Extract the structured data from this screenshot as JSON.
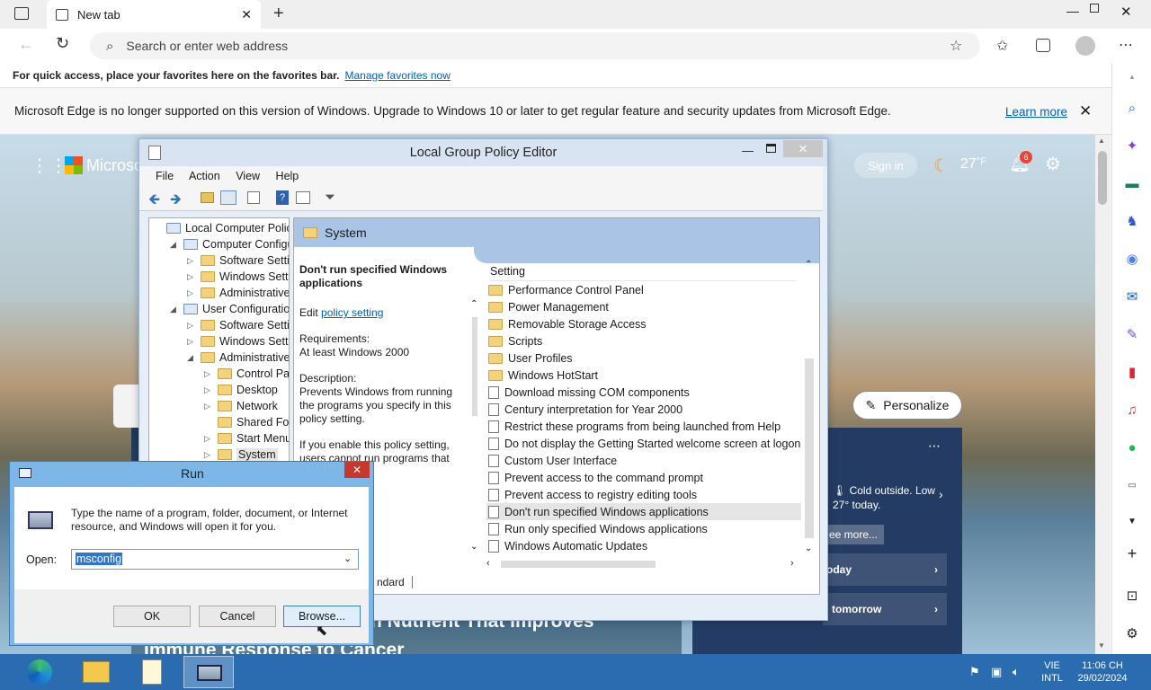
{
  "browser": {
    "tab_title": "New tab",
    "address_placeholder": "Search or enter web address",
    "favorites_text": "For quick access, place your favorites here on the favorites bar.",
    "favorites_link": "Manage favorites now",
    "info_text": "Microsoft Edge is no longer supported on this version of Windows. Upgrade to Windows 10 or later to get regular feature and security updates from Microsoft Edge.",
    "info_link": "Learn more"
  },
  "page": {
    "brand": "Microso",
    "sign_in": "Sign in",
    "temperature": "27",
    "temp_unit": "°F",
    "notif_count": "6",
    "personalize": "Personalize",
    "weather_text": "Cold outside. Low 27° today.",
    "see_more": "ee more...",
    "today": "oday",
    "tomorrow": "tomorrow",
    "headline1": "n Nutrient That Improves",
    "headline2": "Immune Response to Cancer"
  },
  "gpedit": {
    "title": "Local Group Policy Editor",
    "menu": [
      "File",
      "Action",
      "View",
      "Help"
    ],
    "tree": [
      {
        "label": "Local Computer Policy",
        "indent": 0,
        "arrow": ""
      },
      {
        "label": "Computer Configura",
        "indent": 1,
        "arrow": "◢"
      },
      {
        "label": "Software Settings",
        "indent": 2,
        "arrow": "▷"
      },
      {
        "label": "Windows Setting",
        "indent": 2,
        "arrow": "▷"
      },
      {
        "label": "Administrative Te",
        "indent": 2,
        "arrow": "▷"
      },
      {
        "label": "User Configuration",
        "indent": 1,
        "arrow": "◢"
      },
      {
        "label": "Software Settings",
        "indent": 2,
        "arrow": "▷"
      },
      {
        "label": "Windows Setting",
        "indent": 2,
        "arrow": "▷"
      },
      {
        "label": "Administrative Te",
        "indent": 2,
        "arrow": "◢"
      },
      {
        "label": "Control Panel",
        "indent": 3,
        "arrow": "▷"
      },
      {
        "label": "Desktop",
        "indent": 3,
        "arrow": "▷"
      },
      {
        "label": "Network",
        "indent": 3,
        "arrow": "▷"
      },
      {
        "label": "Shared Folder",
        "indent": 3,
        "arrow": ""
      },
      {
        "label": "Start Menu ar",
        "indent": 3,
        "arrow": "▷"
      },
      {
        "label": "System",
        "indent": 3,
        "arrow": "▷"
      }
    ],
    "section_title": "System",
    "desc_heading": "Don't run specified Windows applications",
    "edit_prefix": "Edit",
    "edit_link": "policy setting",
    "requirements_label": "Requirements:",
    "requirements_value": "At least Windows 2000",
    "description_label": "Description:",
    "description_text": "Prevents Windows from running the programs you specify in this policy setting.",
    "desc_more1": "If you enable this policy setting, users cannot run programs that",
    "desc_more2": "t of disallowed",
    "desc_more3": "s policy setting or",
    "desc_more4": "it, users can run",
    "desc_more5": "a only prevents",
    "tab_standard": "ndard",
    "list_header": "Setting",
    "list": [
      {
        "label": "Performance Control Panel",
        "type": "folder"
      },
      {
        "label": "Power Management",
        "type": "folder"
      },
      {
        "label": "Removable Storage Access",
        "type": "folder"
      },
      {
        "label": "Scripts",
        "type": "folder"
      },
      {
        "label": "User Profiles",
        "type": "folder"
      },
      {
        "label": "Windows HotStart",
        "type": "folder"
      },
      {
        "label": "Download missing COM components",
        "type": "policy"
      },
      {
        "label": "Century interpretation for Year 2000",
        "type": "policy"
      },
      {
        "label": "Restrict these programs from being launched from Help",
        "type": "policy"
      },
      {
        "label": "Do not display the Getting Started welcome screen at logon",
        "type": "policy"
      },
      {
        "label": "Custom User Interface",
        "type": "policy"
      },
      {
        "label": "Prevent access to the command prompt",
        "type": "policy"
      },
      {
        "label": "Prevent access to registry editing tools",
        "type": "policy"
      },
      {
        "label": "Don't run specified Windows applications",
        "type": "policy",
        "selected": true
      },
      {
        "label": "Run only specified Windows applications",
        "type": "policy"
      },
      {
        "label": "Windows Automatic Updates",
        "type": "policy"
      }
    ]
  },
  "run": {
    "title": "Run",
    "description": "Type the name of a program, folder, document, or Internet resource, and Windows will open it for you.",
    "open_label": "Open:",
    "input_value": "msconfig",
    "ok": "OK",
    "cancel": "Cancel",
    "browse": "Browse..."
  },
  "taskbar": {
    "lang": "VIE",
    "layout": "INTL",
    "time": "11:06 CH",
    "date": "29/02/2024"
  }
}
